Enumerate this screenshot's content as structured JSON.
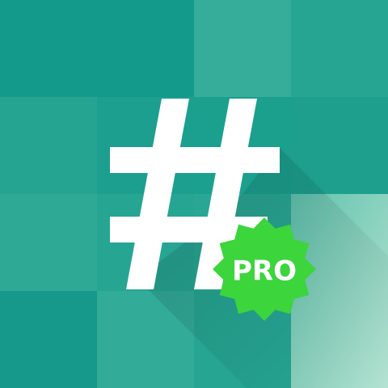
{
  "app_icon": {
    "name": "hash-icon",
    "badge": {
      "label": "PRO",
      "color": "#3cd53c"
    },
    "colors": {
      "background_dark": "#11998a",
      "background_mid": "#1fa290",
      "background_light": "#35ad9a",
      "background_lightest": "#a9ddca",
      "symbol": "#ffffff"
    }
  }
}
